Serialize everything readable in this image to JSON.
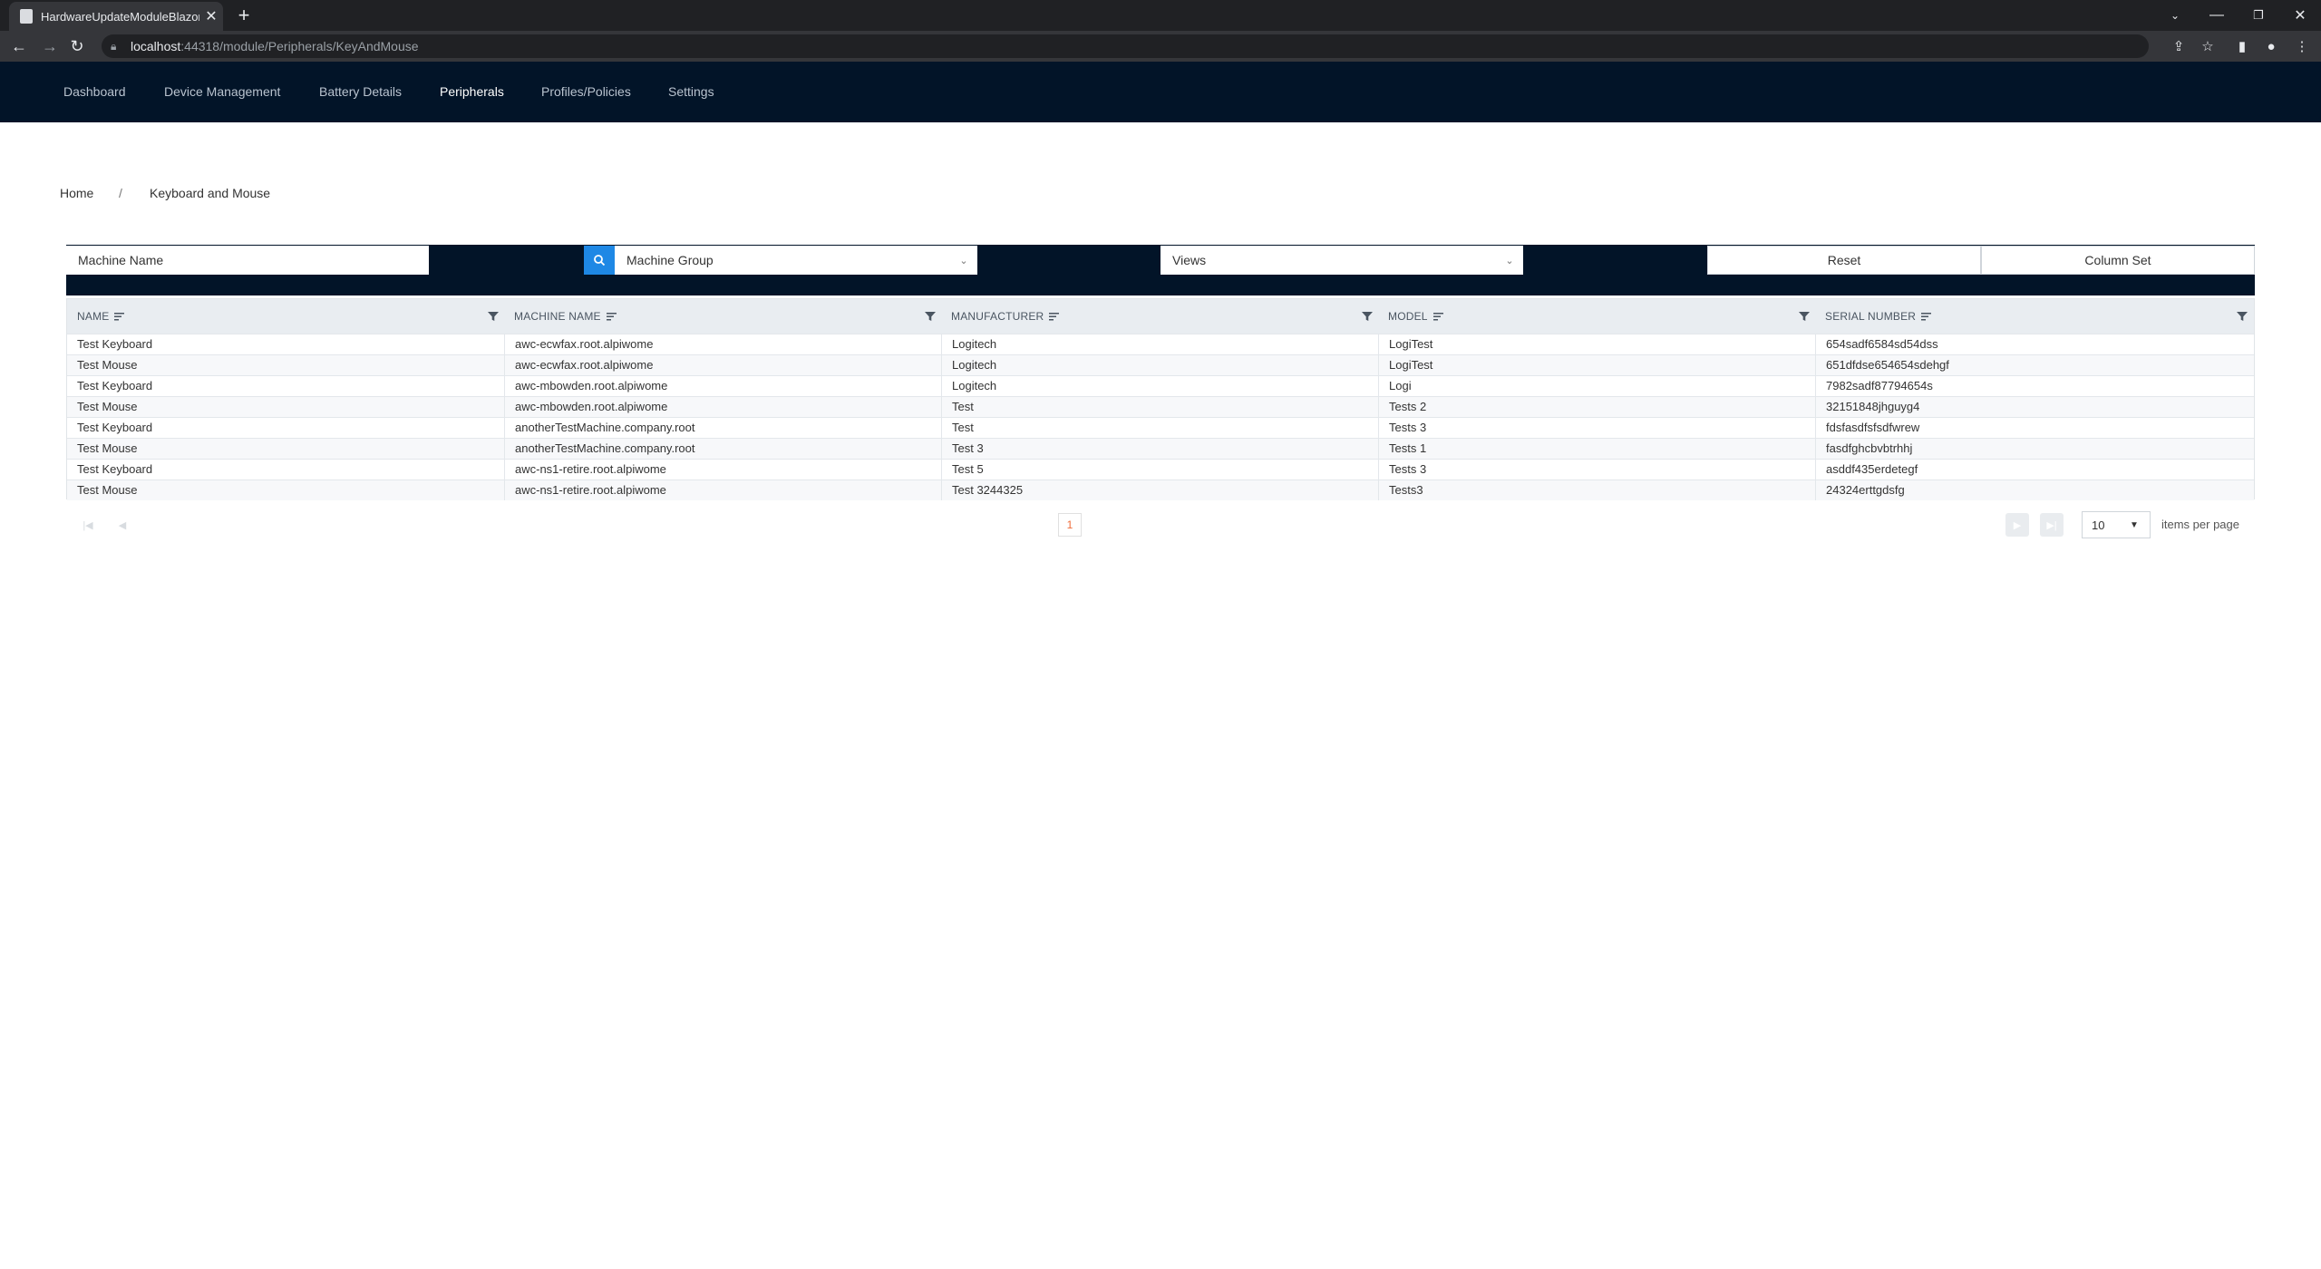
{
  "browser": {
    "tab_title": "HardwareUpdateModuleBlazor",
    "url_host": "localhost",
    "url_path": ":44318/module/Peripherals/KeyAndMouse"
  },
  "nav": {
    "items": [
      "Dashboard",
      "Device Management",
      "Battery Details",
      "Peripherals",
      "Profiles/Policies",
      "Settings"
    ],
    "active": "Peripherals"
  },
  "breadcrumb": {
    "home": "Home",
    "separator": "/",
    "current": "Keyboard and Mouse"
  },
  "filters": {
    "machine_name_placeholder": "Machine Name",
    "machine_group": "Machine Group",
    "views": "Views",
    "reset": "Reset",
    "column_set": "Column Set"
  },
  "grid": {
    "columns": [
      "NAME",
      "MACHINE NAME",
      "MANUFACTURER",
      "MODEL",
      "SERIAL NUMBER"
    ],
    "rows": [
      [
        "Test Keyboard",
        "awc-ecwfax.root.alpiwome",
        "Logitech",
        "LogiTest",
        "654sadf6584sd54dss"
      ],
      [
        "Test Mouse",
        "awc-ecwfax.root.alpiwome",
        "Logitech",
        "LogiTest",
        "651dfdse654654sdehgf"
      ],
      [
        "Test Keyboard",
        "awc-mbowden.root.alpiwome",
        "Logitech",
        "Logi",
        "7982sadf87794654s"
      ],
      [
        "Test Mouse",
        "awc-mbowden.root.alpiwome",
        "Test",
        "Tests 2",
        "32151848jhguyg4"
      ],
      [
        "Test Keyboard",
        "anotherTestMachine.company.root",
        "Test",
        "Tests 3",
        "fdsfasdfsfsdfwrew"
      ],
      [
        "Test Mouse",
        "anotherTestMachine.company.root",
        "Test 3",
        "Tests 1",
        "fasdfghcbvbtrhhj"
      ],
      [
        "Test Keyboard",
        "awc-ns1-retire.root.alpiwome",
        "Test 5",
        "Tests 3",
        "asddf435erdetegf"
      ],
      [
        "Test Mouse",
        "awc-ns1-retire.root.alpiwome",
        "Test 3244325",
        "Tests3",
        "24324erttgdsfg"
      ]
    ]
  },
  "pager": {
    "current_page": "1",
    "page_size": "10",
    "items_per_page_label": "items per page"
  },
  "colors": {
    "nav_bg": "#021428",
    "accent": "#1e88e5",
    "page_active": "#ef6c3a"
  },
  "icons": [
    "page-icon",
    "close-icon",
    "plus-icon",
    "back-icon",
    "forward-icon",
    "reload-icon",
    "lock-icon",
    "share-icon",
    "star-icon",
    "sidebar-icon",
    "profile-icon",
    "menu-icon",
    "search-icon",
    "chevron-down-icon",
    "sort-icon",
    "filter-icon",
    "first-page-icon",
    "prev-page-icon",
    "next-page-icon",
    "last-page-icon"
  ]
}
